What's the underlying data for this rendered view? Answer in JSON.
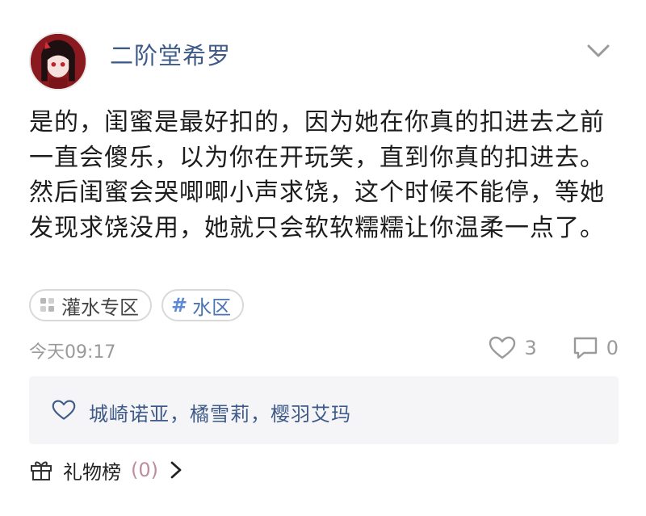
{
  "post": {
    "username": "二阶堂希罗",
    "content": "是的，闺蜜是最好扣的，因为她在你真的扣进去之前一直会傻乐，以为你在开玩笑，直到你真的扣进去。然后闺蜜会哭唧唧小声求饶，这个时候不能停，等她发现求饶没用，她就只会软软糯糯让你温柔一点了。",
    "tags": [
      {
        "label": "灌水专区",
        "icon": "grid-icon"
      },
      {
        "label": "水区",
        "prefix": "#"
      }
    ],
    "time": "今天09:17",
    "like_count": "3",
    "comment_count": "0",
    "liked_by": "城崎诺亚，橘雪莉，樱羽艾玛",
    "gift_label": "礼物榜",
    "gift_count": "(0)"
  },
  "colors": {
    "username": "#3d5a88",
    "meta_gray": "#9a9a9a",
    "likes_bg": "#f5f5f7",
    "tag_hash": "#5a8ad6"
  }
}
